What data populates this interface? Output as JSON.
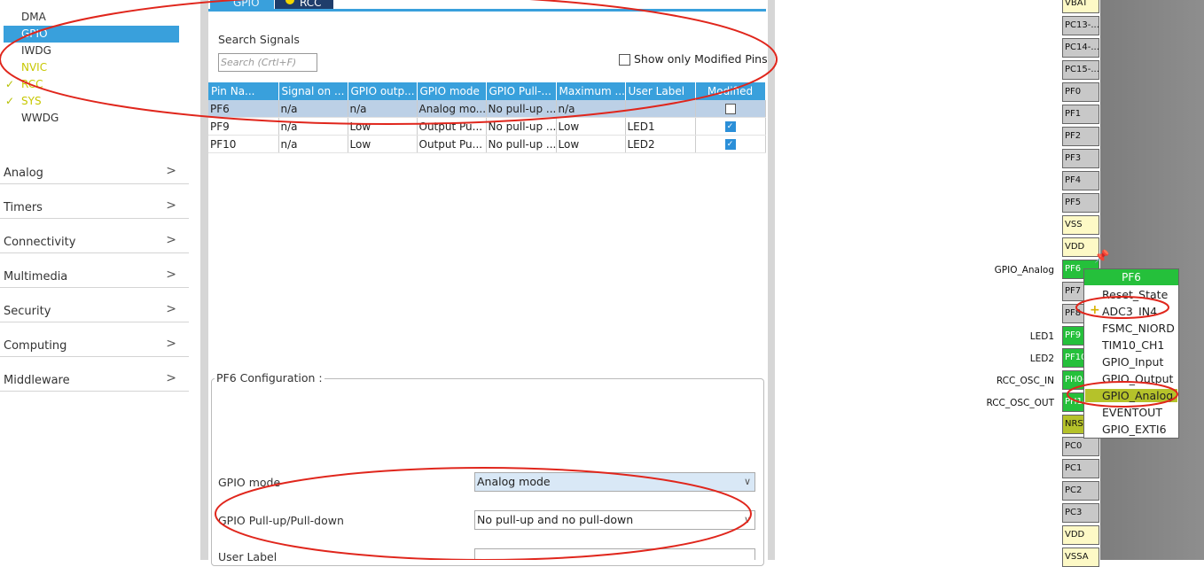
{
  "sidebar": {
    "peripherals": [
      "DMA",
      "GPIO",
      "IWDG",
      "NVIC",
      "RCC",
      "SYS",
      "WWDG"
    ],
    "categories": [
      "Analog",
      "Timers",
      "Connectivity",
      "Multimedia",
      "Security",
      "Computing",
      "Middleware"
    ]
  },
  "tabs": [
    "GPIO",
    "RCC"
  ],
  "search": {
    "label": "Search Signals",
    "placeholder": "Search (Crtl+F)"
  },
  "modified_only_label": "Show only Modified Pins",
  "table": {
    "headers": [
      "Pin Na...",
      "Signal on ...",
      "GPIO outp...",
      "GPIO mode",
      "GPIO Pull-...",
      "Maximum ...",
      "User Label",
      "Modified"
    ],
    "rows": [
      [
        "PF6",
        "n/a",
        "n/a",
        "Analog mo...",
        "No pull-up ...",
        "n/a",
        "",
        false
      ],
      [
        "PF9",
        "n/a",
        "Low",
        "Output Pu...",
        "No pull-up ...",
        "Low",
        "LED1",
        true
      ],
      [
        "PF10",
        "n/a",
        "Low",
        "Output Pu...",
        "No pull-up ...",
        "Low",
        "LED2",
        true
      ]
    ]
  },
  "config": {
    "title": "PF6 Configuration :",
    "gpio_mode_label": "GPIO mode",
    "gpio_mode_value": "Analog mode",
    "pull_label": "GPIO Pull-up/Pull-down",
    "pull_value": "No pull-up and no pull-down",
    "user_label_label": "User Label"
  },
  "pins": [
    {
      "name": "VBAT",
      "color": "yellow"
    },
    {
      "name": "PC13-...",
      "color": "gray"
    },
    {
      "name": "PC14-...",
      "color": "gray"
    },
    {
      "name": "PC15-...",
      "color": "gray"
    },
    {
      "name": "PF0",
      "color": "gray"
    },
    {
      "name": "PF1",
      "color": "gray"
    },
    {
      "name": "PF2",
      "color": "gray"
    },
    {
      "name": "PF3",
      "color": "gray"
    },
    {
      "name": "PF4",
      "color": "gray"
    },
    {
      "name": "PF5",
      "color": "gray"
    },
    {
      "name": "VSS",
      "color": "yellow"
    },
    {
      "name": "VDD",
      "color": "yellow"
    },
    {
      "name": "PF6",
      "color": "green"
    },
    {
      "name": "PF7",
      "color": "gray"
    },
    {
      "name": "PF8",
      "color": "gray"
    },
    {
      "name": "PF9",
      "color": "green"
    },
    {
      "name": "PF10",
      "color": "green"
    },
    {
      "name": "PH0-...",
      "color": "green"
    },
    {
      "name": "PH1-...",
      "color": "green"
    },
    {
      "name": "NRST",
      "color": "olive"
    },
    {
      "name": "PC0",
      "color": "gray"
    },
    {
      "name": "PC1",
      "color": "gray"
    },
    {
      "name": "PC2",
      "color": "gray"
    },
    {
      "name": "PC3",
      "color": "gray"
    },
    {
      "name": "VDD",
      "color": "yellow"
    },
    {
      "name": "VSSA",
      "color": "yellow"
    }
  ],
  "pin_labels": {
    "PF6": "GPIO_Analog",
    "PF9": "LED1",
    "PF10": "LED2",
    "PH0": "RCC_OSC_IN",
    "PH1": "RCC_OSC_OUT"
  },
  "popup": {
    "title": "PF6",
    "items": [
      "Reset_State",
      "ADC3_IN4",
      "FSMC_NIORD",
      "TIM10_CH1",
      "GPIO_Input",
      "GPIO_Output",
      "GPIO_Analog",
      "EVENTOUT",
      "GPIO_EXTI6"
    ],
    "selected": "GPIO_Analog"
  },
  "colors": {
    "accent": "#39a0dc",
    "pin_green": "#25c03b",
    "pin_olive": "#b5c22a",
    "annotation": "#e0261c"
  }
}
